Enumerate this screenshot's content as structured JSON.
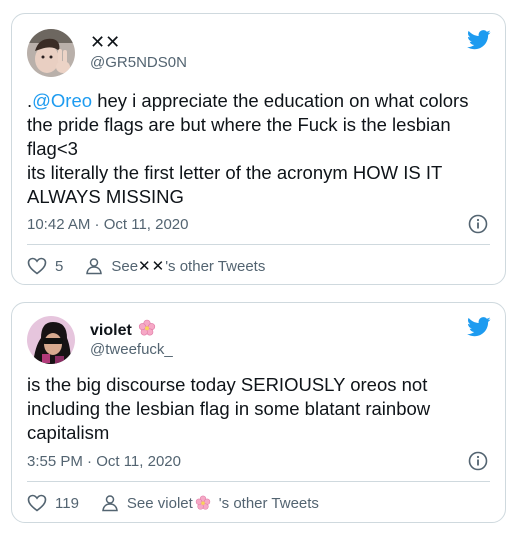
{
  "tweets": [
    {
      "display_name": "✕✕",
      "handle": "@GR5NDS0N",
      "text_prefix": ".",
      "mention": "@Oreo",
      "text_line1_rest": " hey i appreciate the education on what colors",
      "text_line2": "the pride flags are but where the Fuck is the lesbian",
      "text_line3": "flag<3",
      "text_line4": "its literally the first letter of the acronym HOW IS IT",
      "text_line5": "ALWAYS MISSING",
      "timestamp": "10:42 AM · Oct 11, 2020",
      "like_count": "5",
      "see_prefix": "See ",
      "see_name": "✕✕",
      "see_suffix": "'s other Tweets"
    },
    {
      "display_name": "violet",
      "name_emoji": "cherry-blossom-icon",
      "handle": "@tweefuck_",
      "text_line1": "is the big discourse today SERIOUSLY oreos not",
      "text_line2": "including the lesbian flag in some blatant rainbow",
      "text_line3": "capitalism",
      "timestamp": "3:55 PM · Oct 11, 2020",
      "like_count": "119",
      "see_prefix": "See violet",
      "see_suffix": "'s other Tweets"
    }
  ],
  "colors": {
    "accent": "#1d9bf0",
    "text": "#0f1419",
    "muted": "#536471",
    "border": "#cfd9de"
  },
  "icons": [
    "twitter-bird-icon",
    "info-icon",
    "heart-icon",
    "person-icon",
    "cherry-blossom-icon"
  ]
}
